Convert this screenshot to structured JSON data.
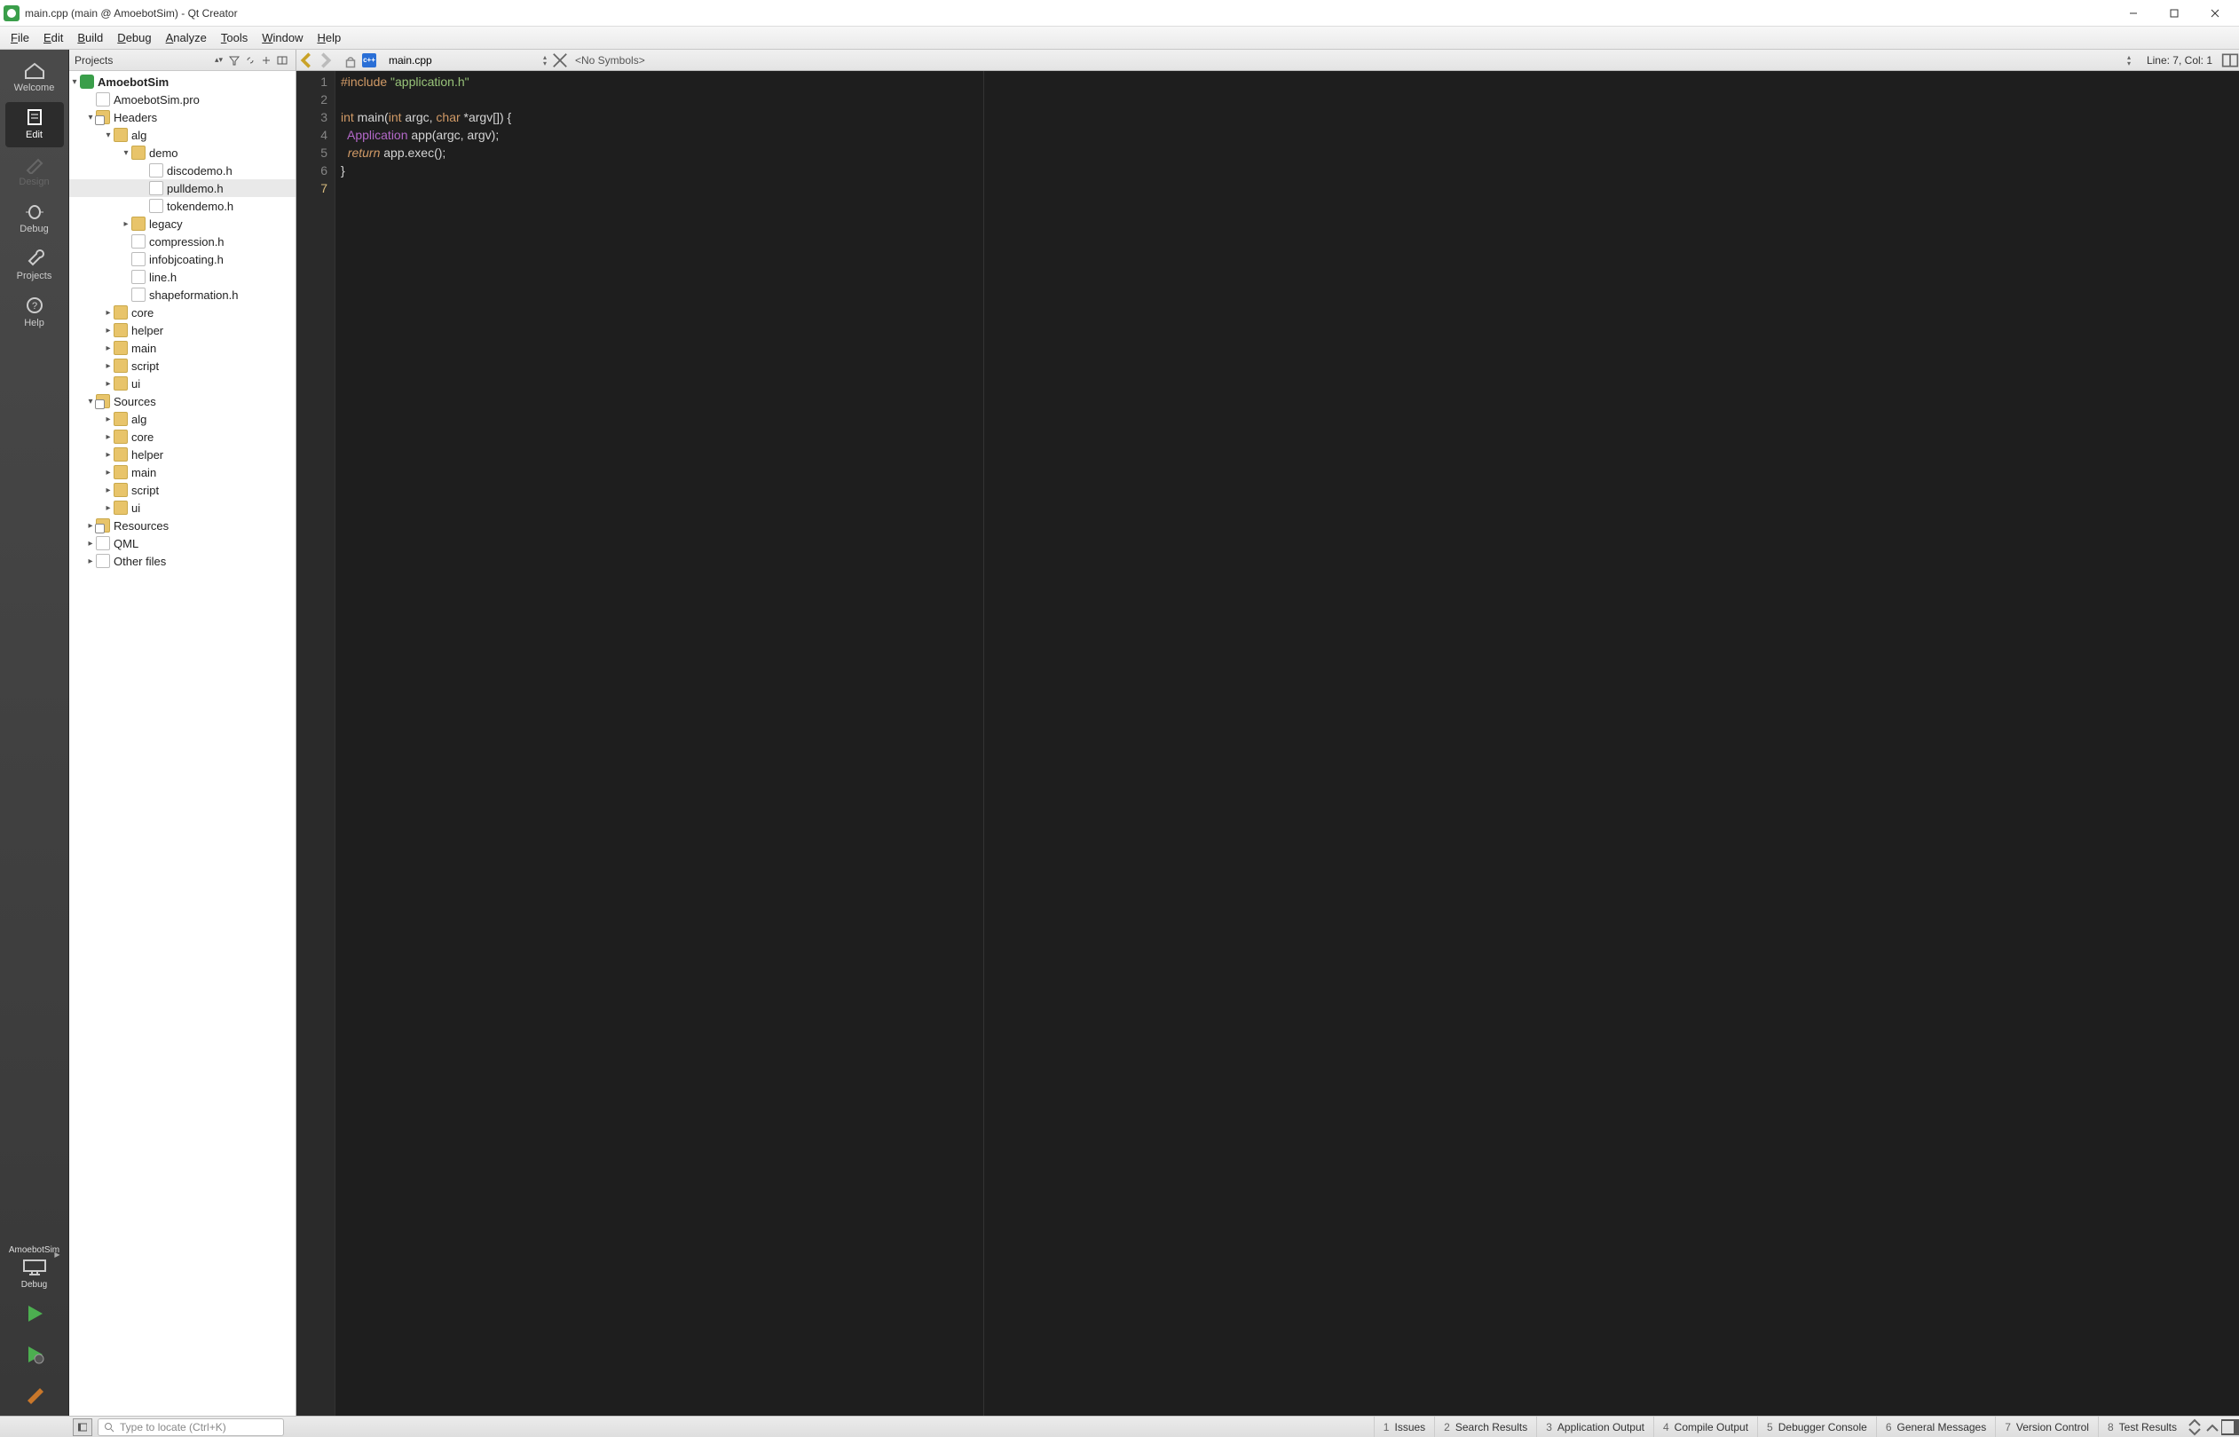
{
  "window": {
    "title": "main.cpp (main @ AmoebotSim) - Qt Creator"
  },
  "menu": {
    "file": "File",
    "edit": "Edit",
    "build": "Build",
    "debug": "Debug",
    "analyze": "Analyze",
    "tools": "Tools",
    "window": "Window",
    "help": "Help"
  },
  "modebar": {
    "welcome": "Welcome",
    "edit": "Edit",
    "design": "Design",
    "debug": "Debug",
    "projects": "Projects",
    "help": "Help",
    "kit_name": "AmoebotSim",
    "kit_mode": "Debug"
  },
  "projects": {
    "header": "Projects",
    "tree": {
      "root": "AmoebotSim",
      "pro": "AmoebotSim.pro",
      "headers": "Headers",
      "alg": "alg",
      "demo": "demo",
      "demo_files": [
        "discodemo.h",
        "pulldemo.h",
        "tokendemo.h"
      ],
      "legacy": "legacy",
      "alg_files": [
        "compression.h",
        "infobjcoating.h",
        "line.h",
        "shapeformation.h"
      ],
      "core": "core",
      "helper": "helper",
      "main_f": "main",
      "script": "script",
      "ui_f": "ui",
      "sources": "Sources",
      "s_alg": "alg",
      "s_core": "core",
      "s_helper": "helper",
      "s_main": "main",
      "s_script": "script",
      "s_ui": "ui",
      "resources": "Resources",
      "qml": "QML",
      "other": "Other files"
    }
  },
  "editor": {
    "filename": "main.cpp",
    "symbols": "<No Symbols>",
    "linecol": "Line: 7, Col: 1",
    "code": {
      "l1_pre": "#include",
      "l1_str": " \"application.h\"",
      "l3_kw_int": "int",
      "l3_main": " main(",
      "l3_kw_int2": "int",
      "l3_argc": " argc, ",
      "l3_kw_char": "char",
      "l3_rest": " *argv[]) {",
      "l4_type": "  Application",
      "l4_rest": " app(argc, argv);",
      "l5_ret": "  return",
      "l5_rest": " app.exec();",
      "l6": "}"
    },
    "line_numbers": [
      "1",
      "2",
      "3",
      "4",
      "5",
      "6",
      "7"
    ]
  },
  "status": {
    "locator_placeholder": "Type to locate (Ctrl+K)",
    "panes": [
      "Issues",
      "Search Results",
      "Application Output",
      "Compile Output",
      "Debugger Console",
      "General Messages",
      "Version Control",
      "Test Results"
    ],
    "pane_nums": [
      "1",
      "2",
      "3",
      "4",
      "5",
      "6",
      "7",
      "8"
    ]
  }
}
